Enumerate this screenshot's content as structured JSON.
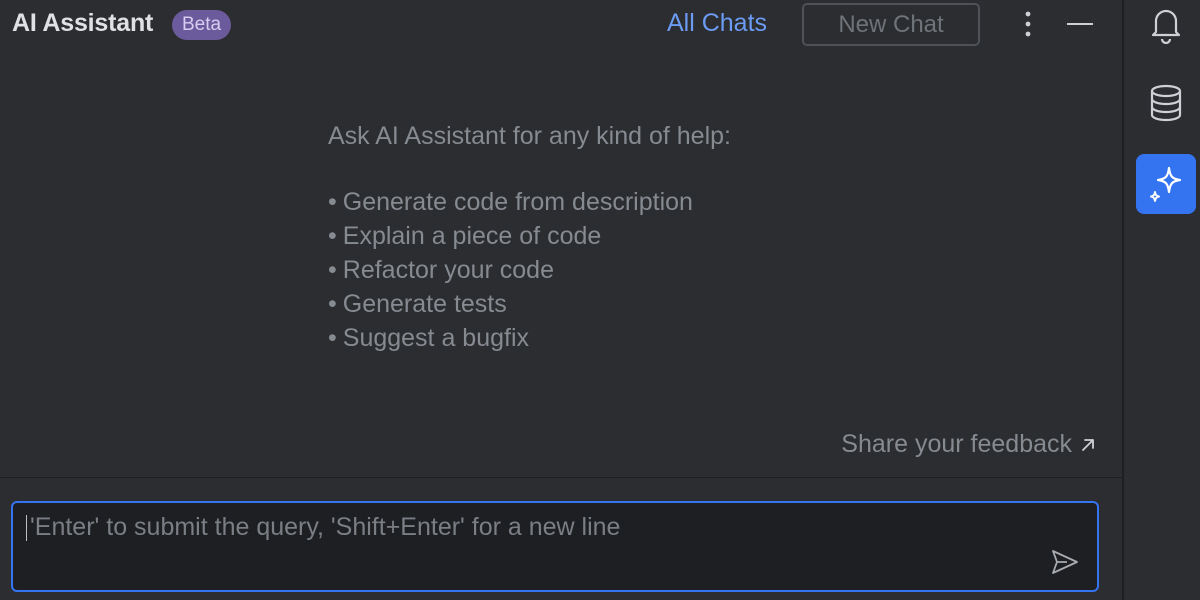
{
  "header": {
    "title": "AI Assistant",
    "badge": "Beta",
    "all_chats_label": "All Chats",
    "new_chat_label": "New Chat"
  },
  "help": {
    "intro": "Ask AI Assistant for any kind of help:",
    "items": [
      "Generate code from description",
      "Explain a piece of code",
      "Refactor your code",
      "Generate tests",
      "Suggest a bugfix"
    ]
  },
  "feedback": {
    "label": "Share your feedback",
    "icon": "arrow-up-right-icon"
  },
  "input": {
    "placeholder": "'Enter' to submit the query, 'Shift+Enter' for a new line"
  },
  "icons": {
    "more": "vertical-dots-icon",
    "minimize": "minimize-icon",
    "send": "send-icon",
    "notifications": "bell-icon",
    "database": "database-icon",
    "ai_assistant": "sparkle-icon"
  },
  "colors": {
    "background": "#2b2d30",
    "input_background": "#1e1f22",
    "accent": "#3574f0",
    "link": "#6b9bf2",
    "beta_badge": "#6c5b9c"
  }
}
